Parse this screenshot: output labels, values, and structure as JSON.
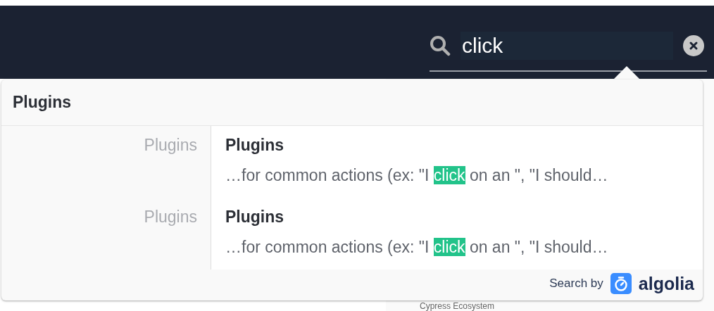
{
  "search": {
    "value": "click"
  },
  "dropdown": {
    "heading": "Plugins",
    "results": [
      {
        "category": "Plugins",
        "title": "Plugins",
        "snippet": {
          "before": "…for common actions (ex: \"I ",
          "match": "click",
          "after": " on an \", \"I should…"
        }
      },
      {
        "category": "Plugins",
        "title": "Plugins",
        "snippet": {
          "before": "…for common actions (ex: \"I ",
          "match": "click",
          "after": " on an \", \"I should…"
        }
      }
    ],
    "footer": {
      "label": "Search by",
      "brand": "algolia"
    }
  },
  "page": {
    "heading": "Cypress Ecosystem"
  }
}
